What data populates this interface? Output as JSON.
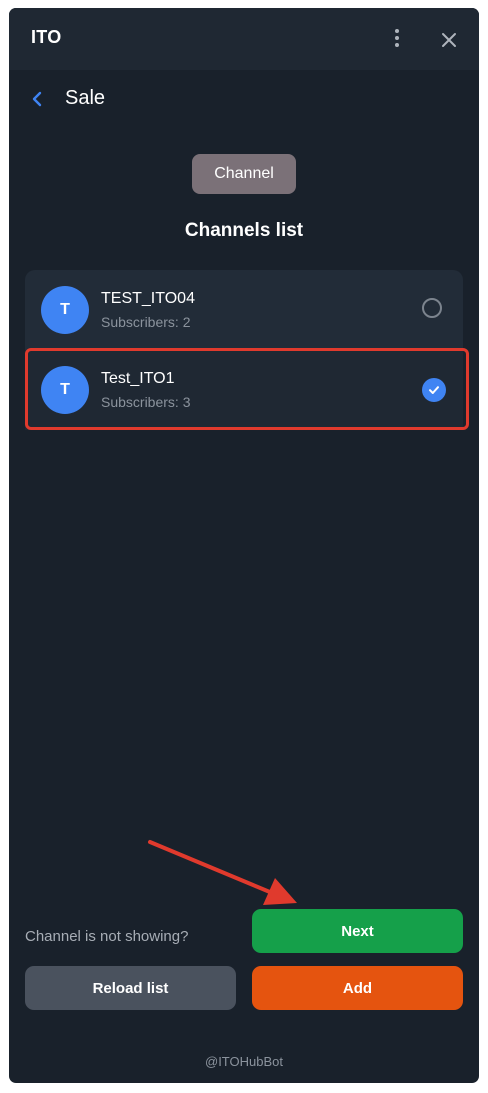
{
  "app": {
    "title": "ITO"
  },
  "nav": {
    "title": "Sale"
  },
  "tabs": [
    {
      "label": "Channel",
      "selected": true
    }
  ],
  "section": {
    "title": "Channels list"
  },
  "channels": [
    {
      "avatar": "T",
      "name": "TEST_ITO04",
      "subscribers": "Subscribers: 2",
      "selected": false
    },
    {
      "avatar": "T",
      "name": "Test_ITO1",
      "subscribers": "Subscribers: 3",
      "selected": true
    }
  ],
  "footer_actions": {
    "hint": "Channel is not showing?",
    "next_label": "Next",
    "reload_label": "Reload list",
    "add_label": "Add"
  },
  "footer": {
    "text": "@ITOHubBot"
  },
  "colors": {
    "background": "#19212b",
    "accent": "#3f84f3",
    "next": "#15a04a",
    "add": "#e5540f",
    "highlight": "#e03a2d"
  },
  "icons": [
    "more-vertical-icon",
    "close-icon",
    "back-chevron-icon",
    "check-icon",
    "annotation-arrow"
  ]
}
